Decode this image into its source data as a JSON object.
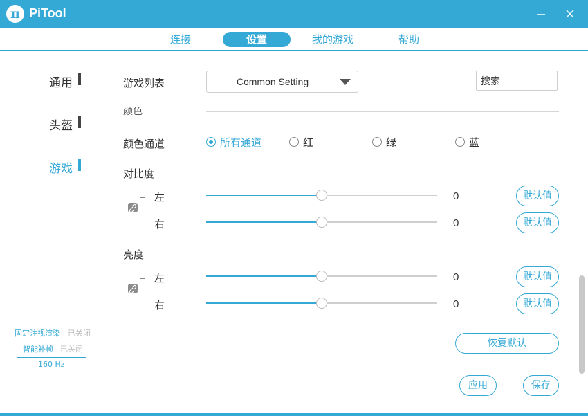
{
  "app": {
    "title": "PiTool",
    "logo": "π"
  },
  "nav": {
    "tabs": [
      "连接",
      "设置",
      "我的游戏",
      "帮助"
    ],
    "active": "设置"
  },
  "sidebar": {
    "items": [
      "通用",
      "头盔",
      "游戏"
    ],
    "active": "游戏",
    "status": {
      "fixed_foveated": "固定注视渲染",
      "fixed_foveated_state": "已关闭",
      "smart_smoothing": "智能补帧",
      "smart_smoothing_state": "已关闭",
      "refresh_rate": "160 Hz"
    }
  },
  "game": {
    "list_label": "游戏列表",
    "list_value": "Common Setting",
    "search_value": "搜索",
    "color_section": "颜色",
    "channel_label": "颜色通道",
    "channels": [
      "所有通道",
      "红",
      "绿",
      "蓝"
    ],
    "selected_channel": "所有通道",
    "contrast": {
      "label": "对比度",
      "left_label": "左",
      "left_value": "0",
      "right_label": "右",
      "right_value": "0",
      "left_level": 0.5,
      "right_level": 0.5
    },
    "brightness": {
      "label": "亮度",
      "left_label": "左",
      "left_value": "0",
      "right_label": "右",
      "right_value": "0",
      "left_level": 0.5,
      "right_level": 0.5
    },
    "default_label": "默认值",
    "restore_label": "恢复默认",
    "apply_label": "应用",
    "save_label": "保存"
  },
  "colors": {
    "accent": "#35a9d6",
    "text": "#333333",
    "muted": "#c0c0c0"
  }
}
